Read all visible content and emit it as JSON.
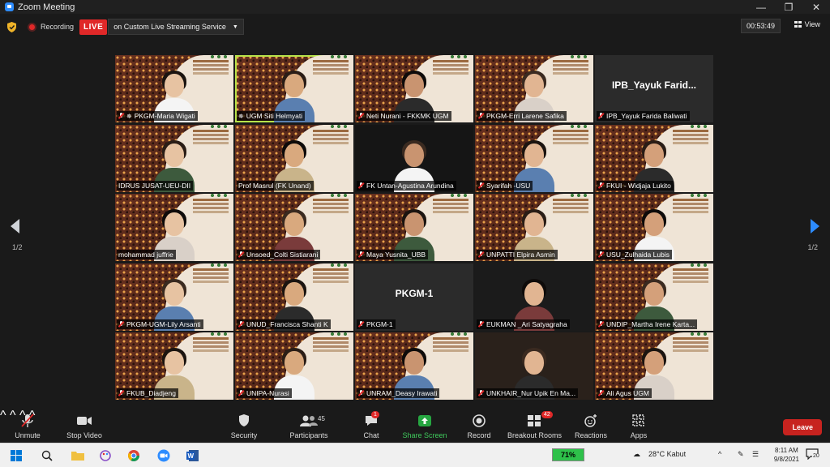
{
  "window": {
    "title": "Zoom Meeting"
  },
  "topbar": {
    "recording_label": "Recording",
    "live_label": "LIVE",
    "stream_label": "on Custom Live Streaming Service",
    "timer": "00:53:49",
    "view_label": "View"
  },
  "pagination": {
    "left": "1/2",
    "right": "1/2"
  },
  "participants": [
    {
      "name": "PKGM-Maria Wigati",
      "muted": true,
      "pinned": true
    },
    {
      "name": "UGM Siti Helmyati",
      "muted": false,
      "pinned": true,
      "speaking": true
    },
    {
      "name": "Neti Nurani - FKKMK UGM",
      "muted": true
    },
    {
      "name": "PKGM-Erri Larene Safika",
      "muted": true
    },
    {
      "name": "IPB_Yayuk Farida Baliwati",
      "muted": true,
      "video_off": true,
      "display": "IPB_Yayuk  Farid..."
    },
    {
      "name": "IDRUS JUSAT-UEU-DII",
      "muted": false
    },
    {
      "name": "Prof Masrul (FK Unand)",
      "muted": false
    },
    {
      "name": "FK Untan-Agustina Arundina",
      "muted": true
    },
    {
      "name": "Syarifah -USU",
      "muted": true
    },
    {
      "name": "FKUI - Widjaja Lukito",
      "muted": true
    },
    {
      "name": "mohammad juffrie",
      "muted": false
    },
    {
      "name": "Unsoed_Colti Sistiarani",
      "muted": true
    },
    {
      "name": "Maya Yusnita_UBB",
      "muted": true
    },
    {
      "name": "UNPATTI Elpira Asmin",
      "muted": true
    },
    {
      "name": "USU_Zulhaida Lubis",
      "muted": true
    },
    {
      "name": "PKGM-UGM-Lily Arsanti",
      "muted": true
    },
    {
      "name": "UNUD_Francisca Shanti K",
      "muted": true
    },
    {
      "name": "PKGM-1",
      "muted": true,
      "video_off": true,
      "display": "PKGM-1"
    },
    {
      "name": "EUKMAN _Ari Satyagraha",
      "muted": true
    },
    {
      "name": "UNDIP_Martha Irene Karta...",
      "muted": true
    },
    {
      "name": "FKUB_Diadjeng",
      "muted": true
    },
    {
      "name": "UNIPA-Nurasi",
      "muted": true
    },
    {
      "name": "UNRAM_Deasy Irawati",
      "muted": true
    },
    {
      "name": "UNKHAIR_Nur Upik En Ma...",
      "muted": true
    },
    {
      "name": "Ali Agus UGM",
      "muted": true
    }
  ],
  "toolbar": {
    "unmute": "Unmute",
    "stop_video": "Stop Video",
    "security": "Security",
    "participants": "Participants",
    "participants_count": "45",
    "chat": "Chat",
    "chat_badge": "1",
    "share_screen": "Share Screen",
    "record": "Record",
    "breakout_rooms": "Breakout Rooms",
    "breakout_badge": "42",
    "reactions": "Reactions",
    "apps": "Apps",
    "leave": "Leave"
  },
  "taskbar": {
    "battery": "71%",
    "weather": "28°C  Kabut",
    "time": "8:11 AM",
    "date": "9/8/2021",
    "notifications": "20"
  },
  "colors": {
    "accent": "#2D8CFF",
    "live_red": "#e02828",
    "leave_red": "#c7231f",
    "speaking": "#b8e34a",
    "share_green": "#26a641"
  }
}
